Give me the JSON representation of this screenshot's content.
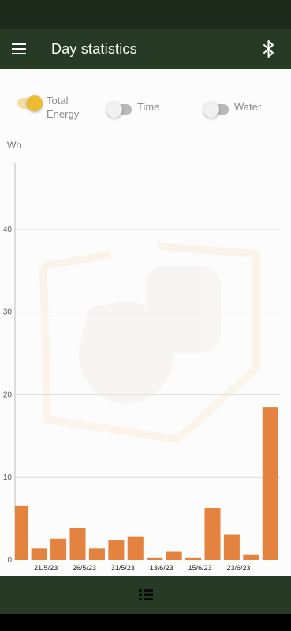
{
  "app_bar": {
    "title": "Day statistics",
    "menu_icon": "hamburger-menu-icon",
    "bluetooth_icon": "bluetooth-icon"
  },
  "toggles": [
    {
      "label": "Total\nEnergy",
      "on": true
    },
    {
      "label": "Time",
      "on": false
    },
    {
      "label": "Water",
      "on": false
    }
  ],
  "colors": {
    "app_bar": "#263a26",
    "bar": "#e3833f",
    "toggle_on": "#ecbb2f"
  },
  "chart_data": {
    "type": "bar",
    "ylabel": "Wh",
    "ylim": [
      0,
      48
    ],
    "yticks": [
      0,
      10,
      20,
      30,
      40
    ],
    "tick_labels": [
      "21/5/23",
      "26/5/23",
      "31/5/23",
      "13/6/23",
      "15/6/23",
      "23/6/23"
    ],
    "values": [
      6.6,
      1.4,
      2.6,
      3.9,
      1.4,
      2.4,
      2.8,
      0.3,
      1.0,
      0.3,
      6.3,
      3.1,
      0.6,
      18.5
    ],
    "grid": true
  },
  "bottom_bar": {
    "list_icon": "list-view-icon"
  }
}
